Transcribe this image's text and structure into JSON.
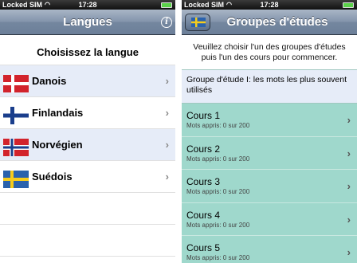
{
  "status": {
    "carrier": "Locked SIM",
    "time": "17:28"
  },
  "left": {
    "title": "Langues",
    "heading": "Choisissez la langue",
    "languages": [
      {
        "name": "Danois",
        "flag": "denmark-flag-icon"
      },
      {
        "name": "Finlandais",
        "flag": "finland-flag-icon"
      },
      {
        "name": "Norvégien",
        "flag": "norway-flag-icon"
      },
      {
        "name": "Suédois",
        "flag": "sweden-flag-icon"
      }
    ]
  },
  "right": {
    "title": "Groupes d'études",
    "intro": "Veuillez choisir l'un des groupes d'études puis l'un des cours pour commencer.",
    "group": "Groupe d'étude I: les mots les plus souvent utilisés",
    "courses": [
      {
        "title": "Cours 1",
        "sub": "Mots appris: 0 sur 200"
      },
      {
        "title": "Cours 2",
        "sub": "Mots appris: 0 sur 200"
      },
      {
        "title": "Cours 3",
        "sub": "Mots appris: 0 sur 200"
      },
      {
        "title": "Cours 4",
        "sub": "Mots appris: 0 sur 200"
      },
      {
        "title": "Cours 5",
        "sub": "Mots appris: 0 sur 200"
      }
    ]
  },
  "colors": {
    "course_bg": "#9fd8cc",
    "nav": "#74879f",
    "alt_row": "#e6ecf8"
  }
}
